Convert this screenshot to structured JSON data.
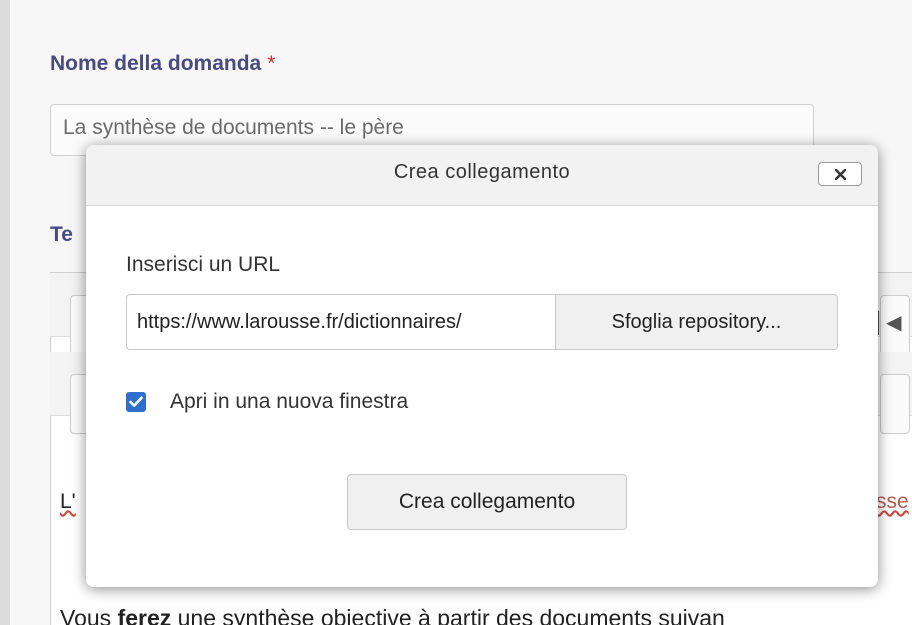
{
  "page": {
    "question_name_label": "Nome della domanda",
    "required_marker": "*",
    "question_name_value": "La synthèse de documents -- le père",
    "question_text_label_partial": "Te",
    "editor_line_1_partial": "L'",
    "editor_line_1_right_partial": "sse",
    "editor_line_2_start": "Vous ",
    "editor_line_2_bold": "ferez",
    "editor_line_2_rest": " une synthèse objective à partir des documents suivan"
  },
  "dialog": {
    "title": "Crea collegamento",
    "close_icon": "close-icon",
    "url_label": "Inserisci un URL",
    "url_value": "https://www.larousse.fr/dictionnaires/",
    "browse_button_label": "Sfoglia repository...",
    "open_new_window_label": "Apri in una nuova finestra",
    "open_new_window_checked": true,
    "create_button_label": "Crea collegamento"
  },
  "colors": {
    "label_color": "#4a4a82",
    "required_color": "#c9302c",
    "checkbox_color": "#2f6fd0"
  }
}
